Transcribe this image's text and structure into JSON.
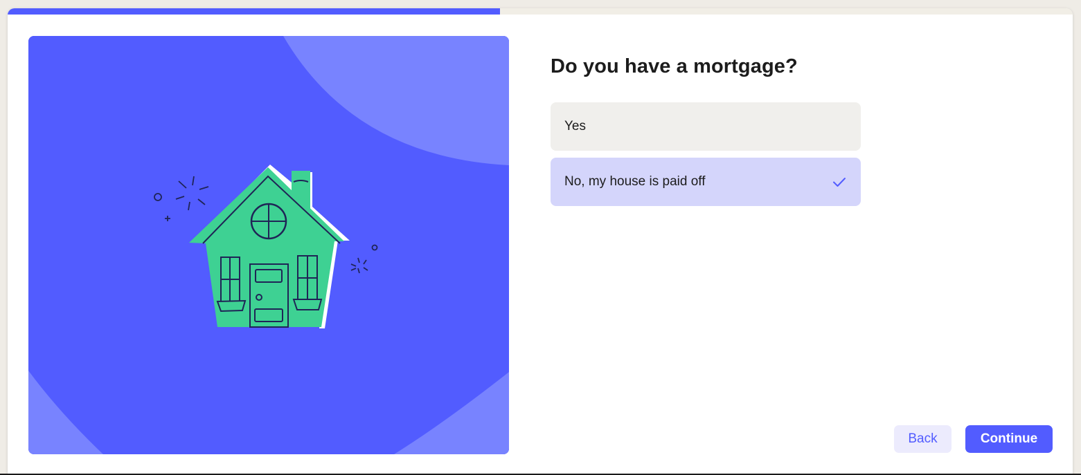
{
  "progress": {
    "fraction": 0.462
  },
  "illustration": {
    "name": "house-illustration"
  },
  "question": {
    "title": "Do you have a mortgage?"
  },
  "options": [
    {
      "label": "Yes",
      "selected": false
    },
    {
      "label": "No, my house is paid off",
      "selected": true,
      "icon": "check-icon"
    }
  ],
  "buttons": {
    "back": "Back",
    "continue": "Continue"
  },
  "colors": {
    "accent": "#525cff",
    "accent_light": "#7883ff",
    "house_green": "#3ed193",
    "selected_option_bg": "#d4d5fb",
    "option_bg": "#f0efec"
  }
}
